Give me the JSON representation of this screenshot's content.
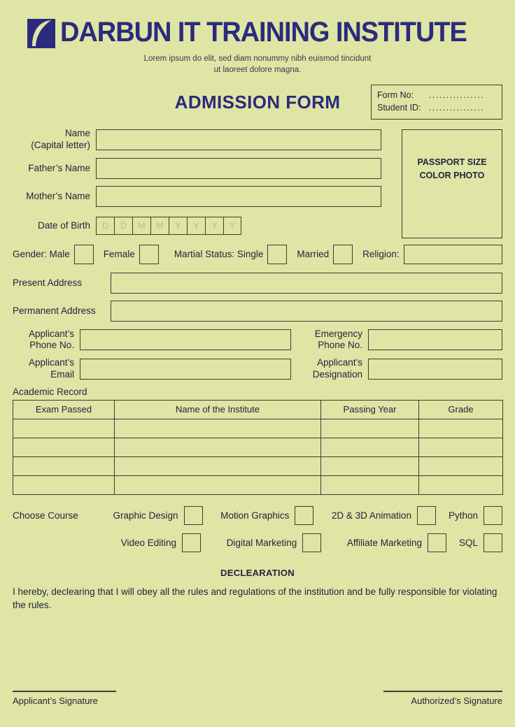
{
  "theme": {
    "background": "#dfe5a4",
    "border": "#3d3d38",
    "brand_navy": "#2b2b7d",
    "text": "#23233f",
    "placeholder": "#b9bf84"
  },
  "header": {
    "logo_name": "darbun-leaf-logo",
    "brand_title": "DARBUN IT TRAINING INSTITUTE",
    "tagline_line1": "Lorem ipsum do elit, sed diam nonummy nibh euismod tincidunt",
    "tagline_line2": "ut laoreet dolore magna.",
    "form_title": "ADMISSION FORM"
  },
  "form_number_box": {
    "form_no_label": "Form No:",
    "form_no_value": "................",
    "student_id_label": "Student ID:",
    "student_id_value": "................"
  },
  "photo_box": {
    "line1": "PASSPORT SIZE",
    "line2": "COLOR PHOTO"
  },
  "fields": {
    "name_line1": "Name",
    "name_line2": "(Capital letter)",
    "name_value": "",
    "fathers_name": "Father’s Name",
    "fathers_name_value": "",
    "mothers_name": "Mother’s Name",
    "mothers_name_value": "",
    "dob_label": "Date of Birth",
    "dob_cells": [
      "D",
      "D",
      "M",
      "M",
      "Y",
      "Y",
      "Y",
      "Y"
    ],
    "present_address": "Present Address",
    "present_address_value": "",
    "permanent_address": "Permanent Address",
    "permanent_address_value": "",
    "applicant_phone_line1": "Applicant’s",
    "applicant_phone_line2": "Phone No.",
    "applicant_phone_value": "",
    "emergency_phone_line1": "Emergency",
    "emergency_phone_line2": "Phone No.",
    "emergency_phone_value": "",
    "applicant_email_line1": "Applicant’s",
    "applicant_email_line2": "Email",
    "applicant_email_value": "",
    "applicant_designation_line1": "Applicant’s",
    "applicant_designation_line2": "Designation",
    "applicant_designation_value": ""
  },
  "gender_row": {
    "gender_label": "Gender: Male",
    "female_label": "Female",
    "marital_label": "Martial Status: Single",
    "married_label": "Married",
    "religion_label": "Religion:",
    "religion_value": ""
  },
  "academic": {
    "section_label": "Academic Record",
    "columns": [
      "Exam Passed",
      "Name of the Institute",
      "Passing Year",
      "Grade"
    ],
    "rows": [
      [
        "",
        "",
        "",
        ""
      ],
      [
        "",
        "",
        "",
        ""
      ],
      [
        "",
        "",
        "",
        ""
      ],
      [
        "",
        "",
        "",
        ""
      ]
    ]
  },
  "courses": {
    "section_label": "Choose Course",
    "row1": [
      "Graphic Design",
      "Motion Graphics",
      "2D & 3D Animation",
      "Python"
    ],
    "row2": [
      "Video Editing",
      "Digital Marketing",
      "Affiliate Marketing",
      "SQL"
    ]
  },
  "declaration": {
    "title": "DECLEARATION",
    "text": "I hereby, declearing that I will obey all the rules and regulations of the institution and be fully responsible for violating the rules."
  },
  "signatures": {
    "applicant": "Applicant’s Signature",
    "authorized": "Authorized’s Signature"
  }
}
